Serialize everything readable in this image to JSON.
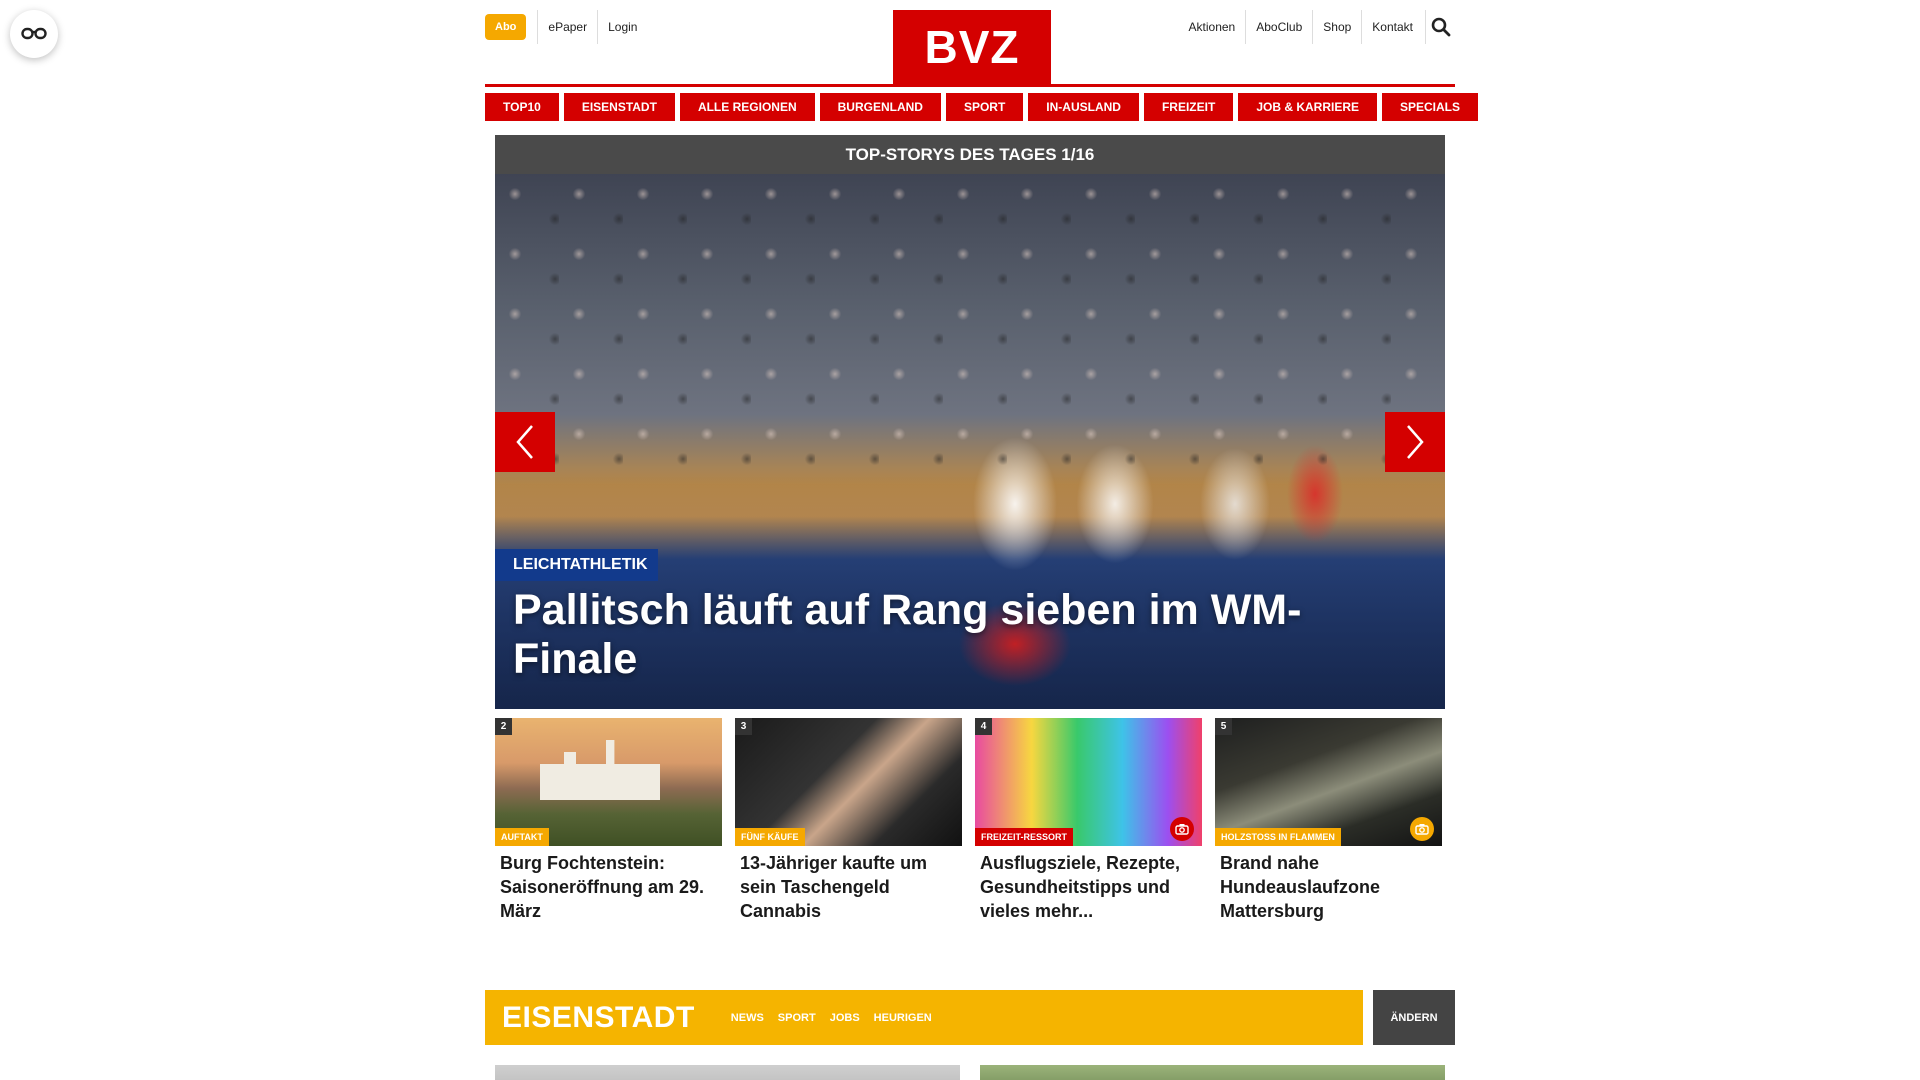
{
  "header": {
    "abo_label": "Abo",
    "left_links": [
      "ePaper",
      "Login"
    ],
    "logo": "BVZ",
    "right_links": [
      "Aktionen",
      "AboClub",
      "Shop",
      "Kontakt"
    ]
  },
  "nav": [
    "TOP10",
    "EISENSTADT",
    "ALLE REGIONEN",
    "BURGENLAND",
    "SPORT",
    "IN-AUSLAND",
    "FREIZEIT",
    "JOB & KARRIERE",
    "SPECIALS"
  ],
  "slider": {
    "heading": "TOP-STORYS DES TAGES 1/16",
    "kicker": "LEICHTATHLETIK",
    "headline": "Pallitsch läuft auf Rang sieben im WM-Finale"
  },
  "thumbs": [
    {
      "num": "2",
      "tag": "AUFTAKT",
      "tag_color": "yellow",
      "title": "Burg Fochtenstein: Saisoneröffnung am 29. März",
      "camera": false
    },
    {
      "num": "3",
      "tag": "FÜNF KÄUFE",
      "tag_color": "yellow",
      "title": "13-Jähriger kaufte um sein Taschengeld Cannabis",
      "camera": false
    },
    {
      "num": "4",
      "tag": "FREIZEIT-RESSORT",
      "tag_color": "red",
      "title": "Ausflugsziele, Rezepte, Gesundheitstipps und vieles mehr...",
      "camera": true
    },
    {
      "num": "5",
      "tag": "HOLZSTOSS IN FLAMMEN",
      "tag_color": "yellow",
      "title": "Brand nahe Hundeauslaufzone Mattersburg",
      "camera": true
    }
  ],
  "region": {
    "title": "EISENSTADT",
    "links": [
      "NEWS",
      "SPORT",
      "JOBS",
      "HEURIGEN"
    ],
    "change_label": "ÄNDERN"
  },
  "colors": {
    "brand_red": "#d40000",
    "abo_yellow": "#f5a800",
    "region_yellow": "#f5b400",
    "kicker_blue": "#123a8c"
  }
}
